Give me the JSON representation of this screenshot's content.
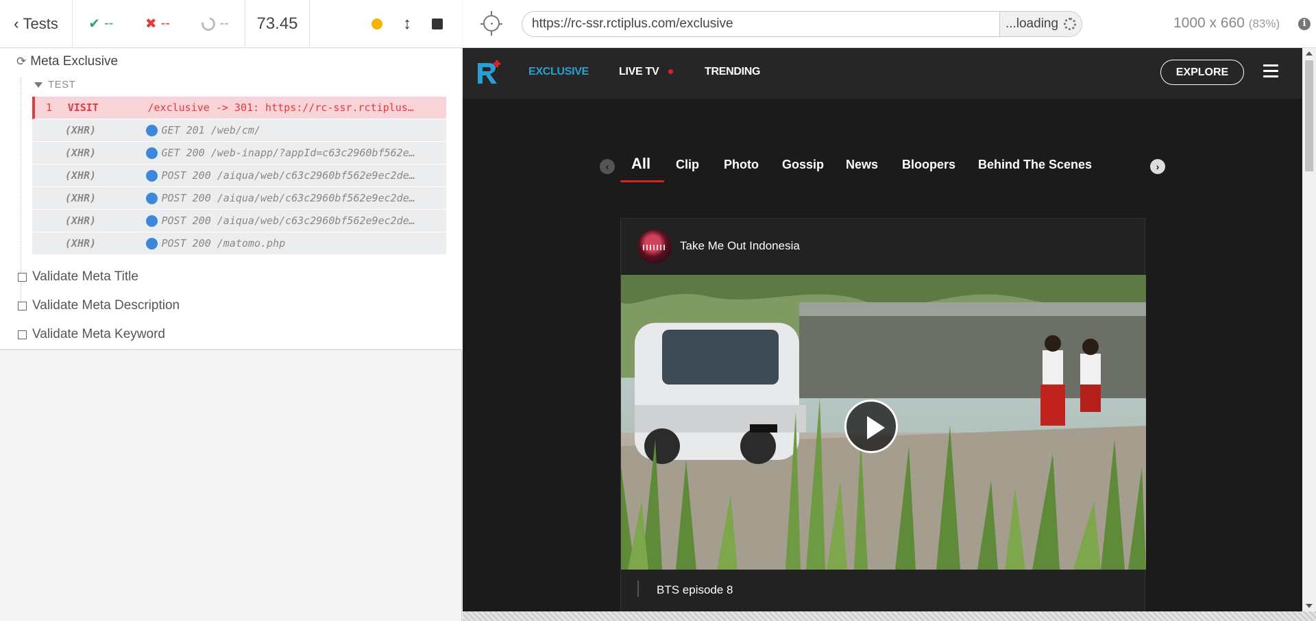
{
  "runner": {
    "back_label": "Tests",
    "passed": "--",
    "failed": "--",
    "pending": "--",
    "duration": "73.45",
    "suite_title": "Meta Exclusive",
    "test_label": "TEST",
    "commands": [
      {
        "num": "1",
        "name": "VISIT",
        "message": "/exclusive -> 301: https://rc-ssr.rctiplus…",
        "type": "visit"
      },
      {
        "num": "",
        "name": "(XHR)",
        "message": "GET 201 /web/cm/",
        "type": "xhr"
      },
      {
        "num": "",
        "name": "(XHR)",
        "message": "GET 200 /web-inapp/?appId=c63c2960bf562e…",
        "type": "xhr"
      },
      {
        "num": "",
        "name": "(XHR)",
        "message": "POST 200 /aiqua/web/c63c2960bf562e9ec2de…",
        "type": "xhr"
      },
      {
        "num": "",
        "name": "(XHR)",
        "message": "POST 200 /aiqua/web/c63c2960bf562e9ec2de…",
        "type": "xhr"
      },
      {
        "num": "",
        "name": "(XHR)",
        "message": "POST 200 /aiqua/web/c63c2960bf562e9ec2de…",
        "type": "xhr"
      },
      {
        "num": "",
        "name": "(XHR)",
        "message": "POST 200 /matomo.php",
        "type": "xhr"
      }
    ],
    "checks": [
      "Validate Meta Title",
      "Validate Meta Description",
      "Validate Meta Keyword"
    ]
  },
  "aut": {
    "url": "https://rc-ssr.rctiplus.com/exclusive",
    "loading_label": "...loading",
    "viewport": "1000 x 660",
    "scale": "(83%)"
  },
  "site": {
    "nav": {
      "exclusive": "EXCLUSIVE",
      "live_tv": "LIVE TV",
      "trending": "TRENDING",
      "explore": "EXPLORE"
    },
    "tabs": [
      "All",
      "Clip",
      "Photo",
      "Gossip",
      "News",
      "Bloopers",
      "Behind The Scenes"
    ],
    "card": {
      "title": "Take Me Out Indonesia",
      "caption": "BTS episode 8"
    }
  },
  "colors": {
    "pass": "#2da579",
    "fail": "#e23b3b",
    "accent": "#2a9fd6",
    "live": "#e02020"
  },
  "icons": {
    "back": "chevron-left-icon",
    "pass": "check-icon",
    "fail": "x-icon",
    "pending": "spinner-icon",
    "selector": "crosshair-icon",
    "info": "info-icon",
    "menu": "hamburger-icon",
    "play": "play-icon"
  }
}
